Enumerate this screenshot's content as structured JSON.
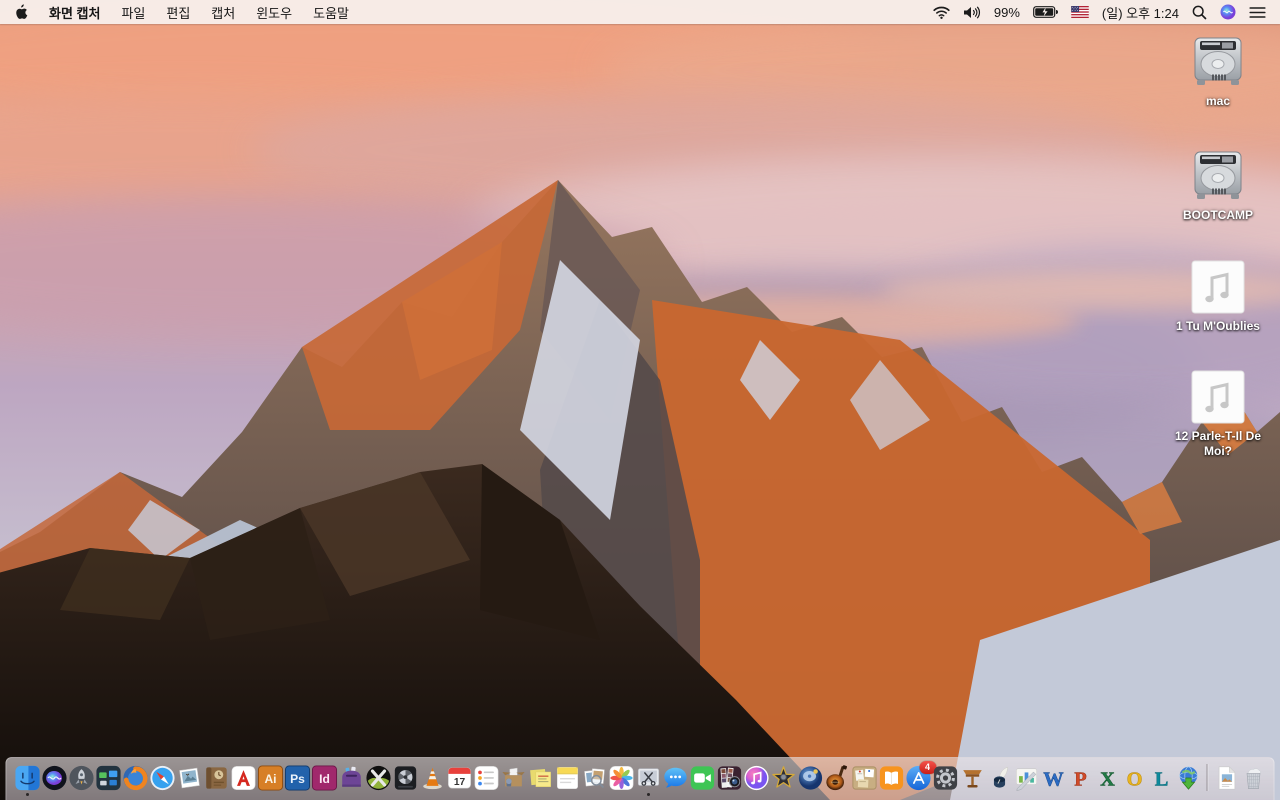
{
  "menubar": {
    "menus": [
      "화면 캡처",
      "파일",
      "편집",
      "캡처",
      "윈도우",
      "도움말"
    ],
    "active_app": "화면 캡처",
    "status": {
      "battery_percent": "99%",
      "battery_state": "charging",
      "input_source": "us-flag",
      "clock": "(일) 오후 1:24",
      "icons": [
        "wifi-icon",
        "volume-icon",
        "battery-icon",
        "input-source-flag",
        "clock",
        "spotlight-icon",
        "siri-icon",
        "notification-center-icon"
      ]
    }
  },
  "desktop": {
    "icons": [
      {
        "label": "mac",
        "type": "hard-drive"
      },
      {
        "label": "BOOTCAMP",
        "type": "hard-drive"
      },
      {
        "label": "1 Tu M'Oublies",
        "type": "audio-file"
      },
      {
        "label": "12 Parle-T-Il De Moi?",
        "type": "audio-file"
      }
    ]
  },
  "dock": {
    "apps": [
      {
        "id": "finder",
        "label": "Finder",
        "running": true
      },
      {
        "id": "siri",
        "label": "Siri"
      },
      {
        "id": "launchpad",
        "label": "Launchpad"
      },
      {
        "id": "mission-control",
        "label": "Mission Control"
      },
      {
        "id": "firefox",
        "label": "Firefox"
      },
      {
        "id": "safari",
        "label": "Safari"
      },
      {
        "id": "image-viewer",
        "label": "Image Viewer"
      },
      {
        "id": "journal",
        "label": "Journal / Planner"
      },
      {
        "id": "acrobat-reader",
        "label": "Adobe Acrobat Reader"
      },
      {
        "id": "illustrator",
        "label": "Adobe Illustrator"
      },
      {
        "id": "photoshop",
        "label": "Adobe Photoshop"
      },
      {
        "id": "indesign",
        "label": "Adobe InDesign"
      },
      {
        "id": "toast",
        "label": "Toast Titanium"
      },
      {
        "id": "xee",
        "label": "Xee Image Viewer"
      },
      {
        "id": "disk-tool",
        "label": "Disk Tool"
      },
      {
        "id": "vlc",
        "label": "VLC"
      },
      {
        "id": "calendar",
        "label": "Calendar"
      },
      {
        "id": "reminders",
        "label": "Reminders"
      },
      {
        "id": "stuffit-expander",
        "label": "StuffIt Expander"
      },
      {
        "id": "stickies",
        "label": "Stickies"
      },
      {
        "id": "notes",
        "label": "Notes"
      },
      {
        "id": "preview",
        "label": "Preview"
      },
      {
        "id": "photos",
        "label": "Photos"
      },
      {
        "id": "grab",
        "label": "화면 캡처 (Grab)",
        "running": true
      },
      {
        "id": "messages",
        "label": "Messages"
      },
      {
        "id": "facetime",
        "label": "FaceTime"
      },
      {
        "id": "photo-booth",
        "label": "Photo Booth"
      },
      {
        "id": "itunes",
        "label": "iTunes"
      },
      {
        "id": "imovie",
        "label": "iMovie"
      },
      {
        "id": "idvd",
        "label": "iDVD"
      },
      {
        "id": "garageband",
        "label": "GarageBand"
      },
      {
        "id": "pinboard",
        "label": "Pinboard App"
      },
      {
        "id": "ibooks",
        "label": "iBooks"
      },
      {
        "id": "app-store",
        "label": "App Store"
      },
      {
        "id": "system-preferences",
        "label": "System Preferences"
      },
      {
        "id": "keynote",
        "label": "Keynote"
      },
      {
        "id": "pages",
        "label": "Pages"
      },
      {
        "id": "numbers",
        "label": "Numbers"
      },
      {
        "id": "word",
        "label": "Microsoft Word"
      },
      {
        "id": "powerpoint",
        "label": "Microsoft PowerPoint"
      },
      {
        "id": "excel",
        "label": "Microsoft Excel"
      },
      {
        "id": "outlook",
        "label": "Microsoft Outlook"
      },
      {
        "id": "lync",
        "label": "Microsoft Lync"
      },
      {
        "id": "downloader",
        "label": "Download Manager"
      }
    ],
    "calendar_day": "17",
    "app_store_badge": "4",
    "logos": {
      "illustrator": "Ai",
      "photoshop": "Ps",
      "indesign": "Id",
      "word": "W",
      "powerpoint": "P",
      "excel": "X",
      "outlook": "O",
      "lync": "L"
    },
    "files_section": [
      "image-document"
    ],
    "trash_state": "full"
  },
  "colors": {
    "menubar_bg": "#f7eeea",
    "sky_top": "#df9579",
    "sky_lavender": "#bda6c1",
    "sunlit_rock": "#c76836",
    "shadow_rock": "#554a4a",
    "snow": "#c3c9d8",
    "foreground_rock": "#2c2019",
    "badge_red": "#d5281f"
  }
}
